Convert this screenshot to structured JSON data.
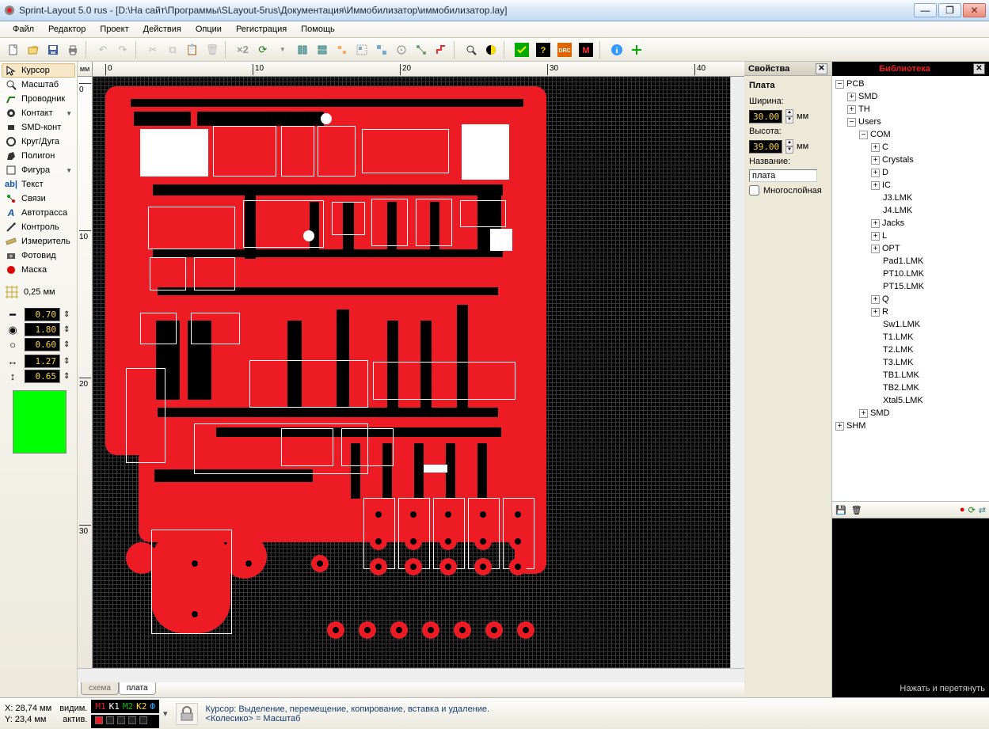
{
  "title": "Sprint-Layout 5.0 rus    -  [D:\\На сайт\\Программы\\SLayout-5rus\\Документация\\Иммобилизатор\\иммобилизатор.lay]",
  "menus": [
    "Файл",
    "Редактор",
    "Проект",
    "Действия",
    "Опции",
    "Регистрация",
    "Помощь"
  ],
  "tools": [
    {
      "id": "cursor",
      "label": "Курсор",
      "active": true
    },
    {
      "id": "zoom",
      "label": "Масштаб"
    },
    {
      "id": "trace",
      "label": "Проводник"
    },
    {
      "id": "pad",
      "label": "Контакт",
      "drop": true
    },
    {
      "id": "smd",
      "label": "SMD-конт"
    },
    {
      "id": "arc",
      "label": "Круг/Дуга"
    },
    {
      "id": "poly",
      "label": "Полигон"
    },
    {
      "id": "shape",
      "label": "Фигура",
      "drop": true
    },
    {
      "id": "text",
      "label": "Текст"
    },
    {
      "id": "net",
      "label": "Связи"
    },
    {
      "id": "autoroute",
      "label": "Автотрасса"
    },
    {
      "id": "check",
      "label": "Контроль"
    },
    {
      "id": "measure",
      "label": "Измеритель"
    },
    {
      "id": "photo",
      "label": "Фотовид"
    },
    {
      "id": "mask",
      "label": "Маска"
    }
  ],
  "grid_label": "0,25 мм",
  "params": [
    {
      "id": "trace_w",
      "val": "0.70"
    },
    {
      "id": "pad_d",
      "val": "1.80"
    },
    {
      "id": "hole_d",
      "val": "0.60"
    },
    {
      "id": "smd_w",
      "val": "1.27"
    },
    {
      "id": "smd_h",
      "val": "0.65"
    }
  ],
  "ruler_unit": "мм",
  "ruler_h": [
    "0",
    "10",
    "20",
    "30",
    "40"
  ],
  "ruler_v": [
    "0",
    "10",
    "20",
    "30"
  ],
  "tabs": [
    {
      "id": "schema",
      "label": "схема",
      "active": false
    },
    {
      "id": "board",
      "label": "плата",
      "active": true
    }
  ],
  "props": {
    "panel": "Свойства",
    "heading": "Плата",
    "width_label": "Ширина:",
    "width": "30.00",
    "height_label": "Высота:",
    "height": "39.00",
    "unit": "мм",
    "name_label": "Название:",
    "name": "плата",
    "multilayer_label": "Многослойная"
  },
  "library": {
    "panel": "Библиотека",
    "preview_hint": "Нажать и перетянуть",
    "tree": [
      {
        "l": "PCB",
        "e": true,
        "c": [
          {
            "l": "SMD",
            "e": false
          },
          {
            "l": "TH",
            "e": false
          },
          {
            "l": "Users",
            "e": true,
            "c": [
              {
                "l": "COM",
                "e": true,
                "c": [
                  {
                    "l": "C",
                    "e": false
                  },
                  {
                    "l": "Crystals",
                    "e": false
                  },
                  {
                    "l": "D",
                    "e": false
                  },
                  {
                    "l": "IC",
                    "e": false
                  },
                  {
                    "l": "J3.LMK"
                  },
                  {
                    "l": "J4.LMK"
                  },
                  {
                    "l": "Jacks",
                    "e": false
                  },
                  {
                    "l": "L",
                    "e": false
                  },
                  {
                    "l": "OPT",
                    "e": false
                  },
                  {
                    "l": "Pad1.LMK"
                  },
                  {
                    "l": "PT10.LMK"
                  },
                  {
                    "l": "PT15.LMK"
                  },
                  {
                    "l": "Q",
                    "e": false
                  },
                  {
                    "l": "R",
                    "e": false
                  },
                  {
                    "l": "Sw1.LMK"
                  },
                  {
                    "l": "T1.LMK"
                  },
                  {
                    "l": "T2.LMK"
                  },
                  {
                    "l": "T3.LMK"
                  },
                  {
                    "l": "TB1.LMK"
                  },
                  {
                    "l": "TB2.LMK"
                  },
                  {
                    "l": "Xtal5.LMK"
                  }
                ]
              },
              {
                "l": "SMD",
                "e": false
              }
            ]
          }
        ]
      },
      {
        "l": "SHM",
        "e": false
      }
    ]
  },
  "status": {
    "x_label": "X:",
    "x": "28,74 мм",
    "y_label": "Y:",
    "y": "23,4 мм",
    "vis_label": "видим.",
    "act_label": "актив.",
    "layers": [
      {
        "t": "М1",
        "c": "#ed1c24"
      },
      {
        "t": "К1",
        "c": "#ffffff"
      },
      {
        "t": "М2",
        "c": "#00c000"
      },
      {
        "t": "К2",
        "c": "#ffd83a"
      },
      {
        "t": "Ф",
        "c": "#26a9ff"
      }
    ],
    "hint1": "Курсор: Выделение, перемещение, копирование, вставка и удаление.",
    "hint2": "<Колесико> = Масштаб"
  }
}
